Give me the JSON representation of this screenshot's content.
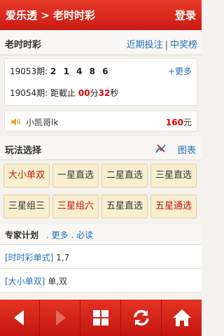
{
  "header": {
    "title": "爱乐透 > 老时时彩",
    "login_label": "登录"
  },
  "subbar": {
    "name": "老时时彩",
    "link_recent": "近期投注",
    "separator": "|",
    "link_winners": "中奖榜"
  },
  "draw": {
    "last_issue": "19053期:",
    "last_numbers": "2 1 4 8 6",
    "more_label": "+更多",
    "next_issue": "19054期:",
    "countdown_prefix": "距截止",
    "minutes": "00",
    "minutes_unit": "分",
    "seconds": "32",
    "seconds_unit": "秒"
  },
  "winner": {
    "user": "小凯哥lk",
    "amount": "160",
    "unit": "元",
    "icon": "speaker-icon"
  },
  "play": {
    "title": "玩法选择",
    "chart_label": "图表",
    "options": [
      {
        "label": "大小单双",
        "hot": true
      },
      {
        "label": "一星直选",
        "hot": false
      },
      {
        "label": "二星直选",
        "hot": false
      },
      {
        "label": "三星直选",
        "hot": false
      },
      {
        "label": "三星组三",
        "hot": false
      },
      {
        "label": "三星组六",
        "hot": true
      },
      {
        "label": "五星直选",
        "hot": false
      },
      {
        "label": "五星通选",
        "hot": true
      }
    ]
  },
  "expert": {
    "title": "专家计划",
    "links": ". 更多 . 必读",
    "plans": [
      {
        "tag": "[时时彩单式]",
        "value": " 1,7"
      },
      {
        "tag": "[大小单双]",
        "value": " 单,双"
      }
    ]
  },
  "tabbar": {
    "items": [
      "back-icon",
      "forward-icon",
      "grid-icon",
      "refresh-icon",
      "home-icon"
    ]
  },
  "colors": {
    "brand_red": "#d0201a",
    "link_blue": "#1f6fb8",
    "highlight_red": "#d00000",
    "cell_bg": "#f9efcf"
  }
}
